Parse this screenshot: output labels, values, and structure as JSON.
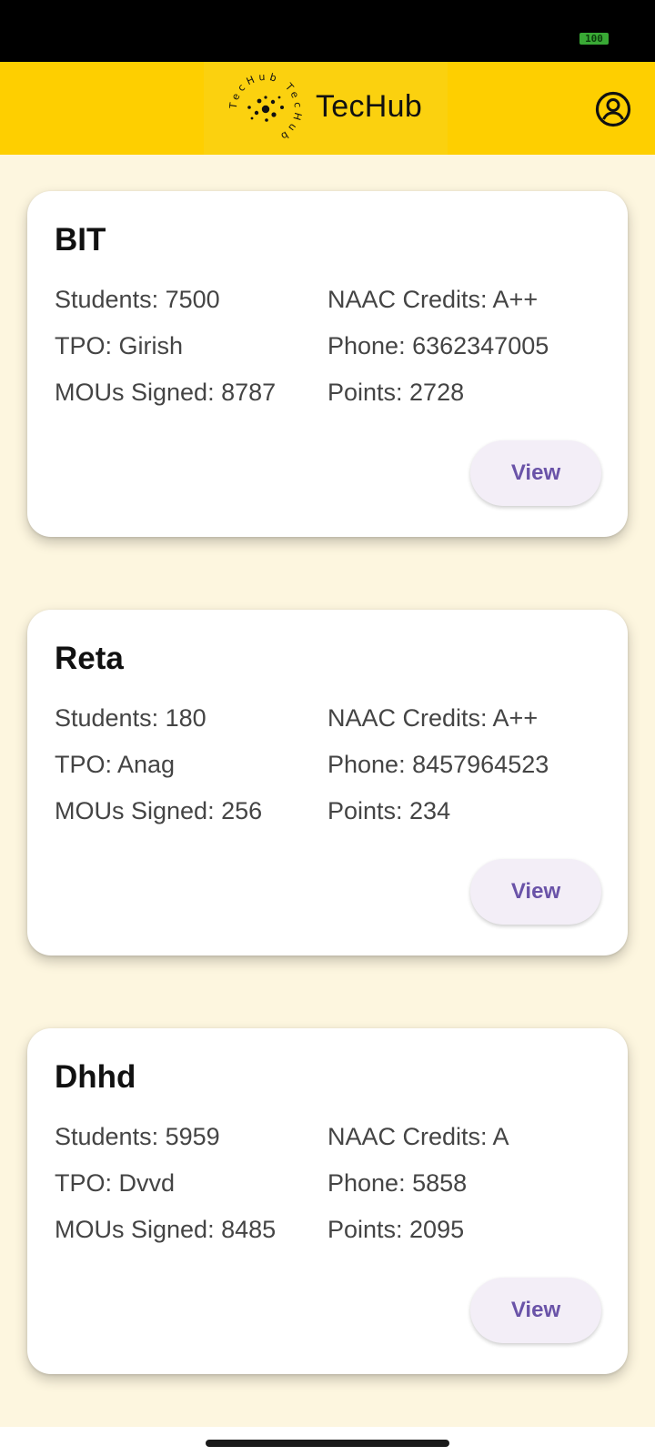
{
  "status_bar": {
    "battery": "100"
  },
  "app_bar": {
    "brand_name": "TecHub",
    "logo_ring_text": "TecHub TecHub",
    "profile_icon": "account-circle-icon"
  },
  "colors": {
    "app_bar": "#FECF00",
    "background": "#FDF6DF",
    "button_bg": "#F3EEF7",
    "button_text": "#6A53A8"
  },
  "colleges": [
    {
      "name": "BIT",
      "students": "Students: 7500",
      "tpo": "TPO: Girish",
      "mous": "MOUs Signed: 8787",
      "naac": "NAAC Credits: A++",
      "phone": "Phone: 6362347005",
      "points": "Points: 2728",
      "view_label": "View"
    },
    {
      "name": "Reta",
      "students": "Students: 180",
      "tpo": "TPO: Anag",
      "mous": "MOUs Signed: 256",
      "naac": "NAAC Credits: A++",
      "phone": "Phone: 8457964523",
      "points": "Points: 234",
      "view_label": "View"
    },
    {
      "name": "Dhhd",
      "students": "Students: 5959",
      "tpo": "TPO: Dvvd",
      "mous": "MOUs Signed: 8485",
      "naac": "NAAC Credits: A",
      "phone": "Phone: 5858",
      "points": "Points: 2095",
      "view_label": "View"
    }
  ]
}
